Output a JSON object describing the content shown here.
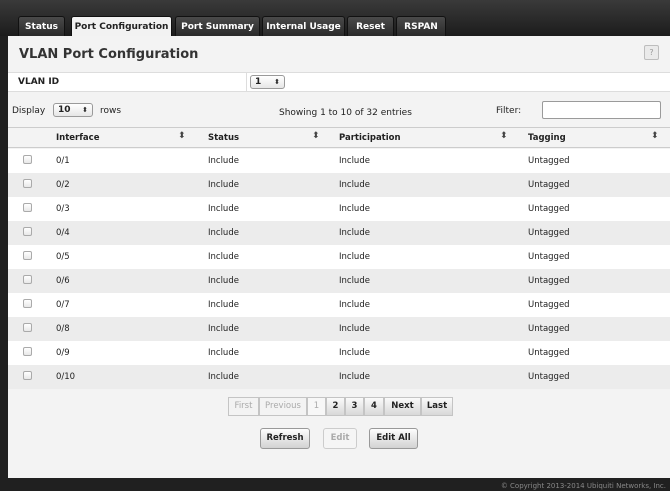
{
  "tabs": [
    {
      "label": "Status",
      "active": false
    },
    {
      "label": "Port Configuration",
      "active": true
    },
    {
      "label": "Port Summary",
      "active": false
    },
    {
      "label": "Internal Usage",
      "active": false
    },
    {
      "label": "Reset",
      "active": false
    },
    {
      "label": "RSPAN",
      "active": false
    }
  ],
  "page": {
    "title": "VLAN Port Configuration",
    "help_label": "?"
  },
  "vlan": {
    "label": "VLAN ID",
    "value": "1"
  },
  "display": {
    "prefix": "Display",
    "rows_value": "10",
    "suffix": "rows",
    "showing": "Showing 1 to 10 of 32 entries",
    "filter_label": "Filter:",
    "filter_value": ""
  },
  "table": {
    "columns": [
      "Interface",
      "Status",
      "Participation",
      "Tagging"
    ],
    "rows": [
      {
        "interface": "0/1",
        "status": "Include",
        "participation": "Include",
        "tagging": "Untagged"
      },
      {
        "interface": "0/2",
        "status": "Include",
        "participation": "Include",
        "tagging": "Untagged"
      },
      {
        "interface": "0/3",
        "status": "Include",
        "participation": "Include",
        "tagging": "Untagged"
      },
      {
        "interface": "0/4",
        "status": "Include",
        "participation": "Include",
        "tagging": "Untagged"
      },
      {
        "interface": "0/5",
        "status": "Include",
        "participation": "Include",
        "tagging": "Untagged"
      },
      {
        "interface": "0/6",
        "status": "Include",
        "participation": "Include",
        "tagging": "Untagged"
      },
      {
        "interface": "0/7",
        "status": "Include",
        "participation": "Include",
        "tagging": "Untagged"
      },
      {
        "interface": "0/8",
        "status": "Include",
        "participation": "Include",
        "tagging": "Untagged"
      },
      {
        "interface": "0/9",
        "status": "Include",
        "participation": "Include",
        "tagging": "Untagged"
      },
      {
        "interface": "0/10",
        "status": "Include",
        "participation": "Include",
        "tagging": "Untagged"
      }
    ]
  },
  "pager": {
    "first": "First",
    "previous": "Previous",
    "pages": [
      "1",
      "2",
      "3",
      "4"
    ],
    "current_page": "1",
    "next": "Next",
    "last": "Last"
  },
  "buttons": {
    "refresh": "Refresh",
    "edit": "Edit",
    "edit_all": "Edit All"
  },
  "footer": {
    "copyright": "© Copyright 2013-2014 Ubiquiti Networks, Inc."
  }
}
